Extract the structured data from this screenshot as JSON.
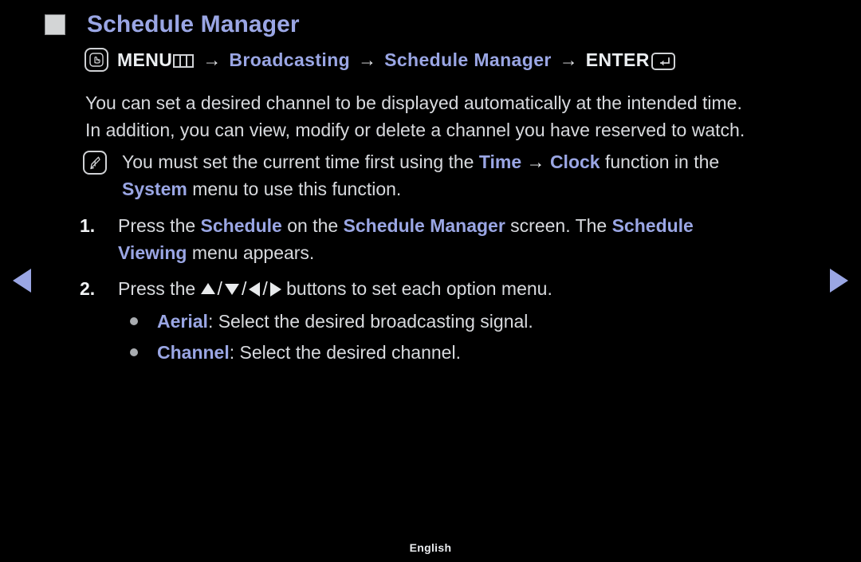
{
  "page": {
    "title": "Schedule Manager",
    "footer_language": "English",
    "background_color": "#000000",
    "accent_color": "#9aa6e4",
    "text_color": "#d8dade"
  },
  "menu_path": {
    "menu_label": "MENU",
    "menu_icon": "menu-bars-icon",
    "touch_icon": "hand-touch-icon",
    "separator": "→",
    "item_broadcasting": "Broadcasting",
    "item_schedule_manager": "Schedule Manager",
    "enter_label": "ENTER",
    "enter_icon": "enter-key-icon"
  },
  "intro": {
    "line1": "You can set a desired channel to be displayed automatically at the intended time.",
    "line2": "In addition, you can view, modify or delete a channel you have reserved to watch."
  },
  "note": {
    "icon": "note-pencil-icon",
    "line1_part1": "You must set the current time first using the ",
    "line1_time": "Time",
    "line1_arrow": "→",
    "line1_clock": "Clock",
    "line1_part2": " function in the",
    "line2_system": "System",
    "line2_rest": " menu to use this function."
  },
  "steps": [
    {
      "number": "1.",
      "line1_part1": "Press the ",
      "line1_schedule": "Schedule",
      "line1_part2": " on the ",
      "line1_schedule_manager": "Schedule Manager",
      "line1_part3": " screen. The ",
      "line1_schedule2": "Schedule",
      "line2_viewing": "Viewing",
      "line2_rest": " menu appears."
    },
    {
      "number": "2.",
      "text_before": "Press the ",
      "buttons": [
        "arrow-up",
        "arrow-down",
        "arrow-left",
        "arrow-right"
      ],
      "text_after": " buttons to set each option menu."
    }
  ],
  "bullets": [
    {
      "term": "Aerial",
      "description": ": Select the desired broadcasting signal."
    },
    {
      "term": "Channel",
      "description": ": Select the desired channel."
    }
  ],
  "navigation": {
    "prev_icon": "triangle-left-icon",
    "next_icon": "triangle-right-icon"
  }
}
